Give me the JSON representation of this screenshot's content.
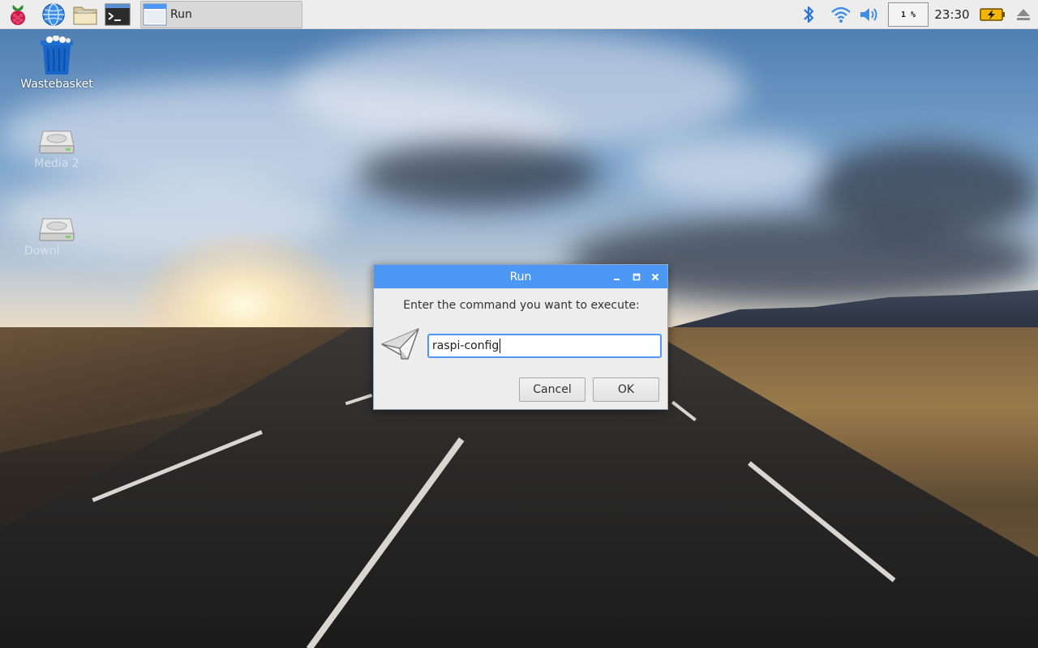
{
  "taskbar": {
    "launchers": [
      {
        "name": "raspberry-menu-icon"
      },
      {
        "name": "web-browser-icon"
      },
      {
        "name": "file-manager-icon"
      },
      {
        "name": "terminal-icon"
      }
    ],
    "task_run_label": "Run",
    "tray": {
      "bluetooth_icon": "bluetooth-icon",
      "wifi_icon": "wifi-icon",
      "volume_icon": "volume-icon",
      "cpu_usage": "1 %",
      "clock": "23:30",
      "battery_icon": "battery-charging-icon",
      "eject_icon": "eject-icon"
    }
  },
  "desktop": {
    "icons": [
      {
        "label": "Wastebasket",
        "icon": "trash-icon"
      },
      {
        "label": "Media 2",
        "icon": "drive-icon"
      },
      {
        "label": "Downl",
        "icon": "drive-icon"
      }
    ]
  },
  "dialog": {
    "title": "Run",
    "prompt": "Enter the command you want to execute:",
    "command_value": "raspi-config",
    "cancel_label": "Cancel",
    "ok_label": "OK",
    "accent_color": "#4d98f5"
  }
}
